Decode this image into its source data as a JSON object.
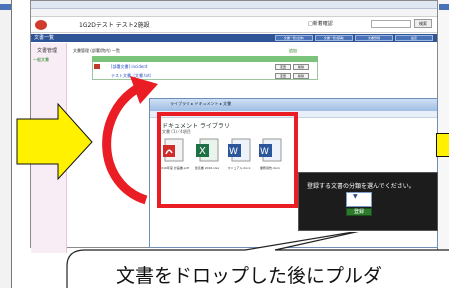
{
  "app": {
    "header_title": "1G2Dテスト テスト2施設",
    "header_right": "□新着確認",
    "search_button": "検索",
    "nav_label": "文書一覧",
    "nav_tabs": [
      "文書一覧(全体)",
      "文書一覧(部署)",
      "文書登録",
      "設定"
    ]
  },
  "sidebar": {
    "title": "文書管理",
    "item": "一般文書"
  },
  "list": {
    "heading": "文書管理 (部署/院内) 一覧",
    "add_label": "追加",
    "rows": [
      {
        "name": "[部署文書] incident",
        "buttons": [
          "変更",
          "削除"
        ]
      },
      {
        "name": "テスト文書（文書.txt）",
        "buttons": [
          "変更",
          "削除"
        ]
      }
    ]
  },
  "explorer": {
    "path": "ライブラリ ▸ ドキュメント ▸ 文書",
    "heading": "ドキュメント ライブラリ",
    "sub": "文書 (1) ⁄ 4項目",
    "files": [
      {
        "label": "2016年度 計画書.pdf",
        "type": "pdf"
      },
      {
        "label": "改善書 2016.xlsx",
        "type": "xlsx"
      },
      {
        "label": "マニュアル.docx",
        "type": "docx"
      },
      {
        "label": "業務報告.docx",
        "type": "docx"
      }
    ]
  },
  "prompt": {
    "text": "登録する文書の分類を選んでください。",
    "select_value": "",
    "confirm_label": "登録"
  },
  "callout": {
    "text": "文書をドロップした後にプルダ"
  },
  "colors": {
    "highlight": "#ea1c24",
    "arrow_yellow": "#fff100",
    "nav_blue": "#2f5597",
    "table_green": "#7bc27b"
  }
}
